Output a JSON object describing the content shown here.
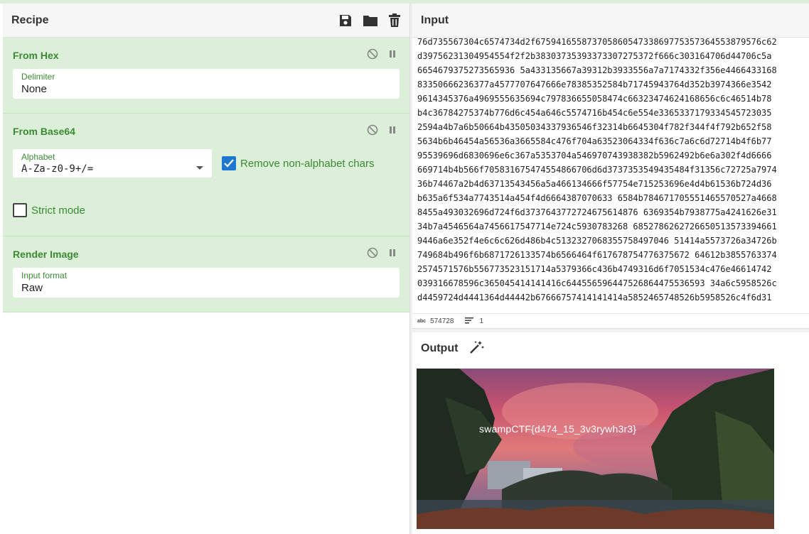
{
  "recipe": {
    "title": "Recipe",
    "operations": [
      {
        "title": "From Hex",
        "field_label": "Delimiter",
        "field_value": "None"
      },
      {
        "title": "From Base64",
        "field_label": "Alphabet",
        "field_value": "A-Za-z0-9+/=",
        "checkbox_label": "Remove non-alphabet chars",
        "checkbox_checked": true,
        "strict_label": "Strict mode",
        "strict_checked": false
      },
      {
        "title": "Render Image",
        "field_label": "Input format",
        "field_value": "Raw"
      }
    ]
  },
  "input": {
    "title": "Input",
    "lines": [
      "76d735567304c6574734d2f67594165587370586054733869775357364553879576c62",
      "d39756231304954554f2f2b38303735393373307275372f666c303164706d44706c5a",
      "6654679375273565936 5a433135667a39312b3933556a7a7174332f356e4466433168",
      "83350666236377a4577707647666e78385352584b71745943764d352b3974366e3542",
      "9614345376a4969555635694c797836655058474c66323474624168656c6c46514b78",
      "b4c36784275374b776d6c454a646c5574716b454c6e554e3365337179334545723035",
      "2594a4b7a6b50664b43505034337936546f32314b6645304f782f344f4f792b652f58",
      "5634b6b46454a56536a3665584c476f704a63523064334f636c7a6c6d72714b4f6b77",
      "95539696d6830696e6c367a5353704a546970743938382b5962492b6e6a302f4d6666",
      "669714b4b566f705831675474554866706d6d3737353549435484f31356c72725a7974",
      "36b74467a2b4d63713543456a5a466134666f57754e715253696e4d4b61536b724d36",
      "b635a6f534a7743514a454f4d6664387070633 6584b784671705551465570527a4668",
      "8455a493032696d724f6d3737643772724675614876 6369354b7938775a4241626e31",
      "34b7a4546564a7456617547714e724c5930783268 6852786262726650513573394661",
      "9446a6e352f4e6c6c626d486b4c5132327068355758497046 51414a5573726a34726b",
      "749684b496f6b6871726133574b6566464f617678754776375672 64612b3855763374",
      "2574571576b556773523151714a5379366c436b4749316d6f7051534c476e46614742",
      "039316678596c365045414141416c644556596447526864475536593 34a6c5958526c",
      "d4459724d4441364d44442b67666757414141414a5852465748526b5958526c4f6d31",
      "34f6a417a4f6a51344b7a41774f6a417775585575644141414141424a52553545726b"
    ],
    "status_label": "abc",
    "char_count": "574728",
    "line_count": "1"
  },
  "output": {
    "title": "Output",
    "flag": "swampCTF{d474_15_3v3rywh3r3}"
  },
  "icons": {
    "save": "save-icon",
    "folder": "folder-icon",
    "trash": "trash-icon",
    "disable": "disable-icon",
    "pause": "pause-icon",
    "magic": "magic-wand-icon"
  },
  "colors": {
    "op_background": "#dcefd8",
    "op_title": "#3b8a33",
    "checkbox_on": "#1e78d2"
  }
}
